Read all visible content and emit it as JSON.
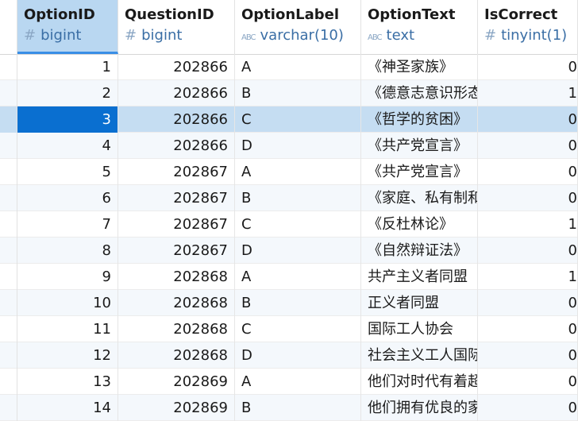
{
  "table": {
    "columns": [
      {
        "name": "OptionID",
        "type": "bigint",
        "type_icon": "#"
      },
      {
        "name": "QuestionID",
        "type": "bigint",
        "type_icon": "#"
      },
      {
        "name": "OptionLabel",
        "type": "varchar(10)",
        "type_icon": "ABC"
      },
      {
        "name": "OptionText",
        "type": "text",
        "type_icon": "ABC"
      },
      {
        "name": "IsCorrect",
        "type": "tinyint(1)",
        "type_icon": "#"
      }
    ],
    "selected_row_index": 2,
    "rows": [
      {
        "OptionID": "1",
        "QuestionID": "202866",
        "OptionLabel": "A",
        "OptionText": "《神圣家族》",
        "IsCorrect": "0"
      },
      {
        "OptionID": "2",
        "QuestionID": "202866",
        "OptionLabel": "B",
        "OptionText": "《德意志意识形态",
        "IsCorrect": "1"
      },
      {
        "OptionID": "3",
        "QuestionID": "202866",
        "OptionLabel": "C",
        "OptionText": "《哲学的贫困》",
        "IsCorrect": "0"
      },
      {
        "OptionID": "4",
        "QuestionID": "202866",
        "OptionLabel": "D",
        "OptionText": "《共产党宣言》",
        "IsCorrect": "0"
      },
      {
        "OptionID": "5",
        "QuestionID": "202867",
        "OptionLabel": "A",
        "OptionText": "《共产党宣言》",
        "IsCorrect": "0"
      },
      {
        "OptionID": "6",
        "QuestionID": "202867",
        "OptionLabel": "B",
        "OptionText": "《家庭、私有制和",
        "IsCorrect": "0"
      },
      {
        "OptionID": "7",
        "QuestionID": "202867",
        "OptionLabel": "C",
        "OptionText": "《反杜林论》",
        "IsCorrect": "1"
      },
      {
        "OptionID": "8",
        "QuestionID": "202867",
        "OptionLabel": "D",
        "OptionText": "《自然辩证法》",
        "IsCorrect": "0"
      },
      {
        "OptionID": "9",
        "QuestionID": "202868",
        "OptionLabel": "A",
        "OptionText": "共产主义者同盟",
        "IsCorrect": "1"
      },
      {
        "OptionID": "10",
        "QuestionID": "202868",
        "OptionLabel": "B",
        "OptionText": "正义者同盟",
        "IsCorrect": "0"
      },
      {
        "OptionID": "11",
        "QuestionID": "202868",
        "OptionLabel": "C",
        "OptionText": "国际工人协会",
        "IsCorrect": "0"
      },
      {
        "OptionID": "12",
        "QuestionID": "202868",
        "OptionLabel": "D",
        "OptionText": "社会主义工人国际",
        "IsCorrect": "0"
      },
      {
        "OptionID": "13",
        "QuestionID": "202869",
        "OptionLabel": "A",
        "OptionText": "他们对时代有着超",
        "IsCorrect": "0"
      },
      {
        "OptionID": "14",
        "QuestionID": "202869",
        "OptionLabel": "B",
        "OptionText": "他们拥有优良的家",
        "IsCorrect": "0"
      }
    ]
  },
  "colors": {
    "selected_header": "#b9d7f1",
    "selected_row": "#c5ddf2",
    "active_cell": "#0a6fd0",
    "alt_row": "#f4f8fc"
  }
}
